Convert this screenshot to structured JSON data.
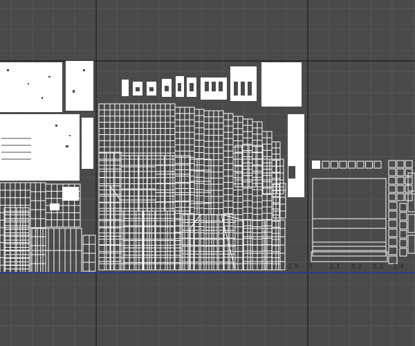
{
  "editor": {
    "view": "uv-editor-canvas",
    "background_color": "#4a4a4a",
    "grid_color": "#555555",
    "major_grid_color": "#1a1a1a",
    "island_color": "#ffffff",
    "axis_line_color": "#2a3c8c"
  },
  "axis": {
    "ticks": [
      "2.9",
      "3",
      "3.1",
      "3.2",
      "3.3",
      "3.4"
    ]
  }
}
